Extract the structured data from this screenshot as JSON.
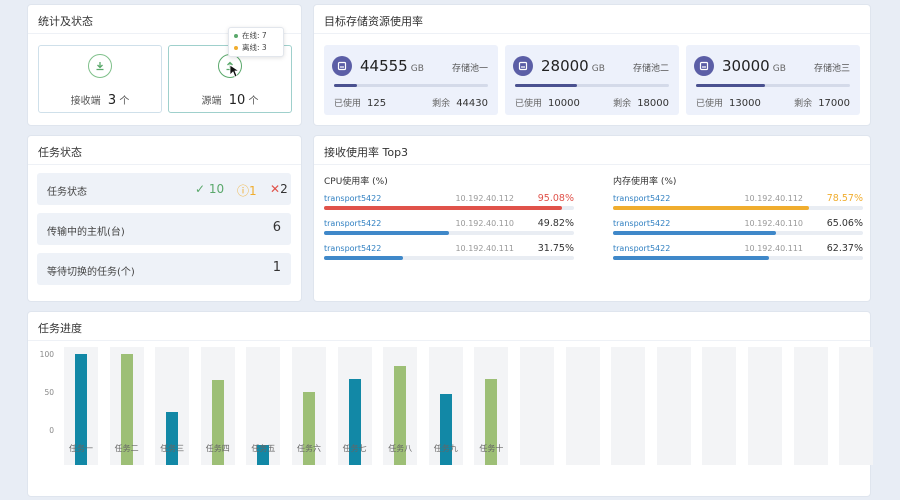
{
  "stats": {
    "title": "统计及状态",
    "receiver": {
      "label": "接收端",
      "count": "3",
      "unit": "个"
    },
    "source": {
      "label": "源端",
      "count": "10",
      "unit": "个"
    },
    "tooltip": {
      "online": "在线: 7",
      "offline": "离线: 3"
    }
  },
  "storage": {
    "title": "目标存储资源使用率",
    "used_label": "已使用",
    "remain_label": "剩余",
    "unit": "GB",
    "pools": [
      {
        "total": "44555",
        "name": "存储池一",
        "used": "125",
        "remain": "44430",
        "used_fraction": 0.15
      },
      {
        "total": "28000",
        "name": "存储池二",
        "used": "10000",
        "remain": "18000",
        "used_fraction": 0.4
      },
      {
        "total": "30000",
        "name": "存储池三",
        "used": "13000",
        "remain": "17000",
        "used_fraction": 0.45
      }
    ]
  },
  "task_status": {
    "title": "任务状态",
    "rows": [
      {
        "label": "任务状态",
        "ok": "10",
        "warn": "1",
        "err": "2"
      },
      {
        "label": "传输中的主机(台)",
        "value": "6"
      },
      {
        "label": "等待切换的任务(个)",
        "value": "1"
      }
    ]
  },
  "top3": {
    "title": "接收使用率 Top3",
    "cpu": {
      "title": "CPU使用率 (%)",
      "items": [
        {
          "name": "transport5422",
          "ip": "10.192.40.112",
          "value": "95.08%",
          "percent": 95.08,
          "color": "#e0524a",
          "value_color": "#e0524a"
        },
        {
          "name": "transport5422",
          "ip": "10.192.40.110",
          "value": "49.82%",
          "percent": 49.82,
          "color": "#3f88c9",
          "value_color": "#333333"
        },
        {
          "name": "transport5422",
          "ip": "10.192.40.111",
          "value": "31.75%",
          "percent": 31.75,
          "color": "#3f88c9",
          "value_color": "#333333"
        }
      ]
    },
    "mem": {
      "title": "内存使用率 (%)",
      "items": [
        {
          "name": "transport5422",
          "ip": "10.192.40.112",
          "value": "78.57%",
          "percent": 78.57,
          "color": "#f0ad2e",
          "value_color": "#f0ad2e"
        },
        {
          "name": "transport5422",
          "ip": "10.192.40.110",
          "value": "65.06%",
          "percent": 65.06,
          "color": "#3f88c9",
          "value_color": "#333333"
        },
        {
          "name": "transport5422",
          "ip": "10.192.40.111",
          "value": "62.37%",
          "percent": 62.37,
          "color": "#3f88c9",
          "value_color": "#333333"
        }
      ]
    }
  },
  "progress": {
    "title": "任务进度"
  },
  "chart_data": {
    "type": "bar",
    "title": "任务进度",
    "categories": [
      "任务一",
      "任务二",
      "任务三",
      "任务四",
      "任务五",
      "任务六",
      "任务七",
      "任务八",
      "任务九",
      "任务十"
    ],
    "values": [
      94,
      94,
      45,
      72,
      17,
      62,
      73,
      84,
      60,
      73
    ],
    "colors": [
      "#1288a6",
      "#9dbf76",
      "#1288a6",
      "#9dbf76",
      "#1288a6",
      "#9dbf76",
      "#1288a6",
      "#9dbf76",
      "#1288a6",
      "#9dbf76"
    ],
    "background_slots": 18,
    "yticks": [
      "100",
      "50",
      "0"
    ],
    "ylim": [
      0,
      100
    ],
    "grid": false
  }
}
